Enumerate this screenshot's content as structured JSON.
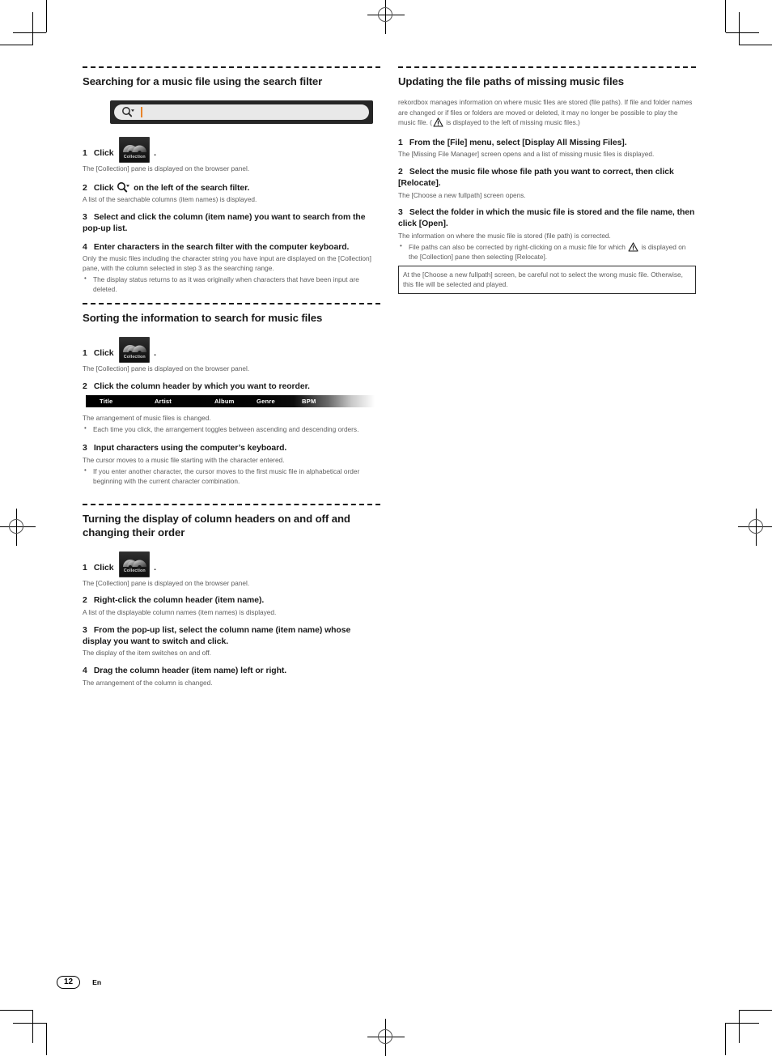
{
  "document": {
    "page_number": "12",
    "language_code": "En"
  },
  "left_column": {
    "section1": {
      "title": "Searching for a music file using the search filter",
      "figure_search_bar": {
        "icon": "magnifier-dropdown-icon",
        "caret_color": "#e8842a"
      },
      "steps": [
        {
          "num": "1",
          "text_before_icon": "Click",
          "icon": "collection-button-icon",
          "icon_label": "Collection",
          "text_after_icon": ".",
          "desc": "The [Collection] pane is displayed on the browser panel."
        },
        {
          "num": "2",
          "text_before_icon": "Click",
          "icon": "magnifier-dropdown-icon",
          "text_after_icon": "on the left of the search filter.",
          "desc": "A list of the searchable columns (item names) is displayed."
        },
        {
          "num": "3",
          "text": "Select and click the column (item name) you want to search from the pop-up list."
        },
        {
          "num": "4",
          "text": "Enter characters in the search filter with the computer keyboard.",
          "desc": "Only the music files including the character string you have input are displayed on the [Collection] pane, with the column selected in step 3 as the searching range.",
          "bullets": [
            "The display status returns to as it was originally when characters that have been input are deleted."
          ]
        }
      ]
    },
    "section2": {
      "title": "Sorting the information to search for music files",
      "steps": [
        {
          "num": "1",
          "text_before_icon": "Click",
          "icon": "collection-button-icon",
          "icon_label": "Collection",
          "text_after_icon": ".",
          "desc": "The [Collection] pane is displayed on the browser panel."
        },
        {
          "num": "2",
          "text": "Click the column header by which you want to reorder.",
          "figure_columns": [
            "Title",
            "Artist",
            "Album",
            "Genre",
            "BPM"
          ],
          "desc": "The arrangement of music files is changed.",
          "bullets": [
            "Each time you click, the arrangement toggles between ascending and descending orders."
          ]
        },
        {
          "num": "3",
          "text": "Input characters using the computer’s keyboard.",
          "desc": "The cursor moves to a music file starting with the character entered.",
          "bullets": [
            "If you enter another character, the cursor moves to the first music file in alphabetical order beginning with the current character combination."
          ]
        }
      ]
    },
    "section3": {
      "title": "Turning the display of column headers on and off and changing their order",
      "steps": [
        {
          "num": "1",
          "text_before_icon": "Click",
          "icon": "collection-button-icon",
          "icon_label": "Collection",
          "text_after_icon": ".",
          "desc": "The [Collection] pane is displayed on the browser panel."
        },
        {
          "num": "2",
          "text": "Right-click the column header (item name).",
          "desc": "A list of the displayable column names (item names) is displayed."
        },
        {
          "num": "3",
          "text": "From the pop-up list, select the column name (item name) whose display you want to switch and click.",
          "desc": "The display of the item switches on and off."
        },
        {
          "num": "4",
          "text": "Drag the column header (item name) left or right.",
          "desc": "The arrangement of the column is changed."
        }
      ]
    }
  },
  "right_column": {
    "section1": {
      "title": "Updating the file paths of missing music files",
      "intro_part1": "rekordbox manages information on where music files are stored (file paths). If file and folder names are changed or if files or folders are moved or deleted, it may no longer be possible to play the music file. (",
      "intro_icon": "warning-triangle-icon",
      "intro_part2": " is displayed to the left of missing music files.)",
      "steps": [
        {
          "num": "1",
          "text": "From the [File] menu, select [Display All Missing Files].",
          "desc": "The [Missing File Manager] screen opens and a list of missing music files is displayed."
        },
        {
          "num": "2",
          "text": "Select the music file whose file path you want to correct, then click [Relocate].",
          "desc": "The [Choose a new fullpath] screen opens."
        },
        {
          "num": "3",
          "text": "Select the folder in which the music file is stored and the file name, then click [Open].",
          "desc": "The information on where the music file is stored (file path) is corrected.",
          "bullet_part1": "File paths can also be corrected by right-clicking on a music file for which ",
          "bullet_icon": "warning-triangle-icon",
          "bullet_part2": " is displayed on the [Collection] pane then selecting [Relocate]."
        }
      ],
      "note": "At the [Choose a new fullpath] screen, be careful not to select the wrong music file. Otherwise, this file will be selected and played."
    }
  }
}
